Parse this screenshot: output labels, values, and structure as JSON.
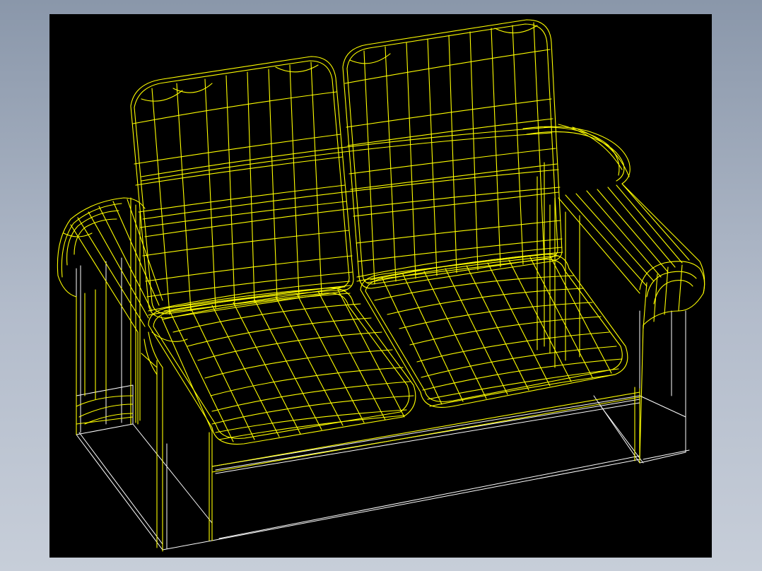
{
  "viewport": {
    "background_color": "#000000",
    "line_color_primary": "#ffff00",
    "line_color_secondary": "#ffffff",
    "content": "wireframe-two-seat-sofa"
  },
  "page": {
    "background_colors": [
      "#8a97aa",
      "#c7ced9"
    ]
  }
}
